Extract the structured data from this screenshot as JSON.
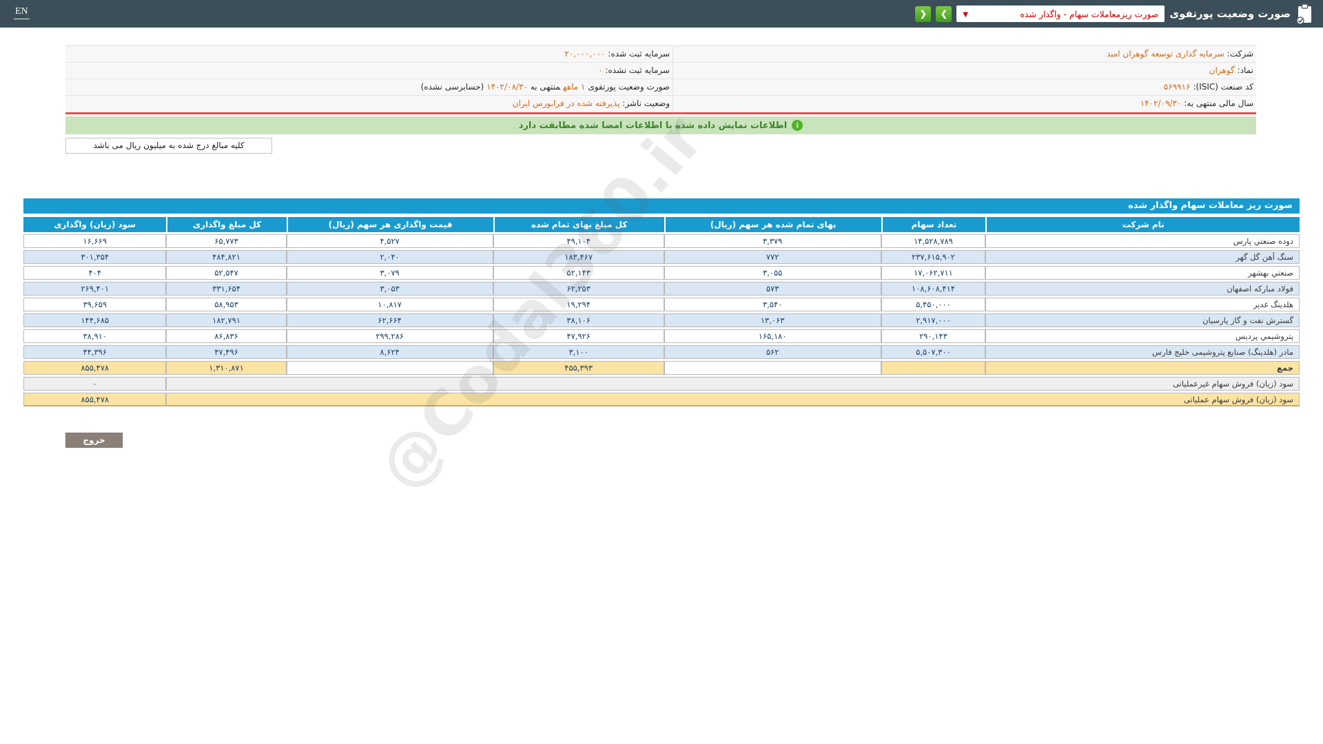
{
  "topbar": {
    "en_label": "EN",
    "title": "صورت وضعیت پورتفوی",
    "dropdown_value": "صورت ریزمعاملات سهام - واگذار شده",
    "dropdown_caret": "▼",
    "nav_back_label": "❮",
    "nav_forward_label": "❯",
    "bar_color": "#3c4f58",
    "button_green": "#4ea526",
    "dropdown_text_color": "#cc0000"
  },
  "info": {
    "value_color": "#cf6d1c",
    "rows": [
      {
        "right": [
          {
            "t": "شرکت:"
          },
          {
            "t": "سرمایه گذاری توسعه گوهران امید",
            "o": true
          }
        ],
        "left": [
          {
            "t": "سرمایه ثبت شده:"
          },
          {
            "t": "۲۰,۰۰۰,۰۰۰",
            "o": true
          }
        ]
      },
      {
        "right": [
          {
            "t": "نماد:"
          },
          {
            "t": "گوهران",
            "o": true
          }
        ],
        "left": [
          {
            "t": "سرمایه ثبت نشده:"
          },
          {
            "t": "۰",
            "o": true
          }
        ]
      },
      {
        "right": [
          {
            "t": "کد صنعت (ISIC):"
          },
          {
            "t": "۵۶۹۹۱۶",
            "o": true
          }
        ],
        "left": [
          {
            "t": "صورت وضعیت پورتفوی"
          },
          {
            "t": "۱ ماهه",
            "o": true
          },
          {
            "t": "منتهی به"
          },
          {
            "t": "۱۴۰۲/۰۸/۳۰",
            "o": true
          },
          {
            "t": "(حسابرسی نشده)"
          }
        ]
      },
      {
        "right": [
          {
            "t": "سال مالی منتهی به:"
          },
          {
            "t": "۱۴۰۲/۰۹/۳۰",
            "o": true
          }
        ],
        "left": [
          {
            "t": "وضعیت ناشر:"
          },
          {
            "t": "پذیرفته شده در فرابورس ایران",
            "o": true
          }
        ]
      }
    ]
  },
  "banner": {
    "text": "اطلاعات نمایش داده شده با اطلاعات امضا شده مطابقت دارد",
    "icon": "info-circle-icon",
    "bg": "#c9e4bd",
    "text_color": "#3c8625"
  },
  "note": {
    "text": "کلیه مبالغ درج شده به میلیون ریال می باشد"
  },
  "main_table": {
    "title": "صورت ریز معاملات سهام واگذار شده",
    "header_color": "#1a9bd0",
    "alt_row_color": "#d9e7f5",
    "total_row_color": "#fbe3a3",
    "columns": [
      "نام شرکت",
      "تعداد سهام",
      "بهای تمام شده هر سهم (ریال)",
      "کل مبلغ بهای تمام شده",
      "قیمت واگذاری هر سهم (ریال)",
      "کل مبلغ واگذاری",
      "سود (زیان) واگذاری"
    ],
    "rows": [
      [
        "دوده صنعتي پارس",
        "۱۴,۵۲۸,۷۸۹",
        "۳,۳۷۹",
        "۴۹,۱۰۴",
        "۴,۵۲۷",
        "۶۵,۷۷۳",
        "۱۶,۶۶۹"
      ],
      [
        "سنگ آهن گل گهر",
        "۲۳۷,۶۱۵,۹۰۲",
        "۷۷۲",
        "۱۸۳,۴۶۷",
        "۲,۰۴۰",
        "۴۸۴,۸۲۱",
        "۳۰۱,۳۵۴"
      ],
      [
        "صنعتي بهشهر",
        "۱۷,۰۶۲,۷۱۱",
        "۳,۰۵۵",
        "۵۲,۱۴۳",
        "۳,۰۷۹",
        "۵۲,۵۴۷",
        "۴۰۴"
      ],
      [
        "فولاد مبارکه اصفهان",
        "۱۰۸,۶۰۸,۴۱۴",
        "۵۷۳",
        "۶۲,۲۵۳",
        "۳,۰۵۳",
        "۳۳۱,۶۵۴",
        "۲۶۹,۴۰۱"
      ],
      [
        "هلدینگ غدیر",
        "۵,۴۵۰,۰۰۰",
        "۳,۵۴۰",
        "۱۹,۲۹۴",
        "۱۰,۸۱۷",
        "۵۸,۹۵۳",
        "۳۹,۶۵۹"
      ],
      [
        "گسترش نفت و گاز پارسیان",
        "۲,۹۱۷,۰۰۰",
        "۱۳,۰۶۳",
        "۳۸,۱۰۶",
        "۶۲,۶۶۴",
        "۱۸۲,۷۹۱",
        "۱۴۴,۶۸۵"
      ],
      [
        "پتروشیمي پردیس",
        "۲۹۰,۱۴۳",
        "۱۶۵,۱۸۰",
        "۴۷,۹۲۶",
        "۲۹۹,۲۸۶",
        "۸۶,۸۳۶",
        "۳۸,۹۱۰"
      ],
      [
        "مادر (هلدینگ) صنایع پتروشیمی خلیج فارس",
        "۵,۵۰۷,۳۰۰",
        "۵۶۲",
        "۳,۱۰۰",
        "۸,۶۲۴",
        "۴۷,۴۹۶",
        "۴۴,۳۹۶"
      ]
    ],
    "total_row": {
      "cells": [
        "جمع",
        "",
        "",
        "۴۵۵,۳۹۳",
        "",
        "۱,۳۱۰,۸۷۱",
        "۸۵۵,۴۷۸"
      ],
      "blank_cols": [
        2,
        4
      ]
    },
    "extra_rows": [
      {
        "label": "سود (زیان) فروش سهام غیرعملیاتی",
        "value": "۰",
        "theme": "gray"
      },
      {
        "label": "سود (زیان) فروش سهام عملیاتی",
        "value": "۸۵۵,۴۷۸",
        "theme": "yellow"
      }
    ]
  },
  "exit": {
    "label": "خروج"
  },
  "watermark": {
    "text": "@Codal360.ir"
  }
}
